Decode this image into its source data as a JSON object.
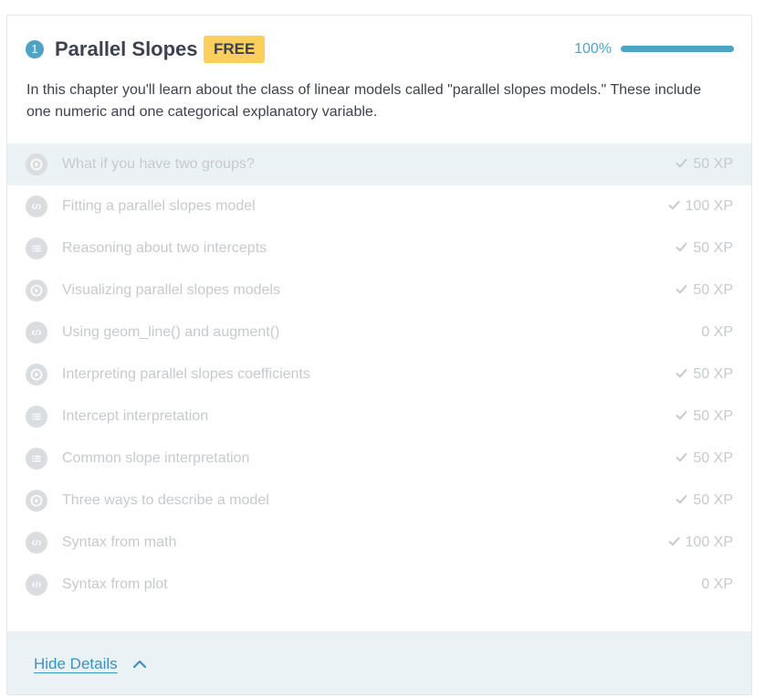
{
  "chapter": {
    "number": "1",
    "title": "Parallel Slopes",
    "badge": "FREE",
    "progress_text": "100%",
    "progress_fraction": 1.0,
    "description": "In this chapter you'll learn about the class of linear models called \"parallel slopes models.\" These include one numeric and one categorical explanatory variable."
  },
  "colors": {
    "accent": "#4fa3c7",
    "badge": "#fcce5b",
    "muted_text": "#c6cacd",
    "highlight_row": "#ebf2f6"
  },
  "exercises": [
    {
      "type": "video-icon",
      "title": "What if you have two groups?",
      "xp": "50 XP",
      "completed": true
    },
    {
      "type": "code-icon",
      "title": "Fitting a parallel slopes model",
      "xp": "100 XP",
      "completed": true
    },
    {
      "type": "list-icon",
      "title": "Reasoning about two intercepts",
      "xp": "50 XP",
      "completed": true
    },
    {
      "type": "video-icon",
      "title": "Visualizing parallel slopes models",
      "xp": "50 XP",
      "completed": true
    },
    {
      "type": "code-icon",
      "title": "Using geom_line() and augment()",
      "xp": "0 XP",
      "completed": false
    },
    {
      "type": "video-icon",
      "title": "Interpreting parallel slopes coefficients",
      "xp": "50 XP",
      "completed": true
    },
    {
      "type": "list-icon",
      "title": "Intercept interpretation",
      "xp": "50 XP",
      "completed": true
    },
    {
      "type": "list-icon",
      "title": "Common slope interpretation",
      "xp": "50 XP",
      "completed": true
    },
    {
      "type": "video-icon",
      "title": "Three ways to describe a model",
      "xp": "50 XP",
      "completed": true
    },
    {
      "type": "code-icon",
      "title": "Syntax from math",
      "xp": "100 XP",
      "completed": true
    },
    {
      "type": "code-icon",
      "title": "Syntax from plot",
      "xp": "0 XP",
      "completed": false
    }
  ],
  "footer": {
    "toggle_label": "Hide Details"
  }
}
